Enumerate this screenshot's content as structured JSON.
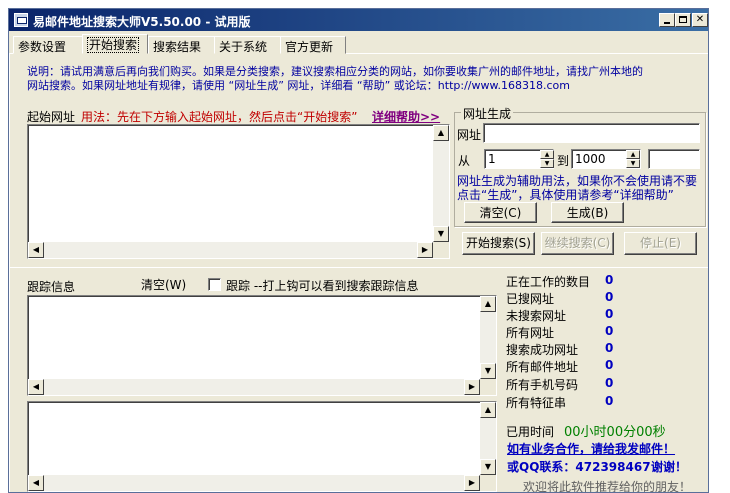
{
  "window": {
    "title": "易邮件地址搜索大师V5.50.00 - 试用版"
  },
  "tabs": [
    {
      "label": "参数设置"
    },
    {
      "label": "开始搜索"
    },
    {
      "label": "搜索结果"
    },
    {
      "label": "关于系统"
    },
    {
      "label": "官方更新"
    }
  ],
  "notice": {
    "line1": "说明：请试用满意后再向我们购买。如果是分类搜索，建议搜索相应分类的网站，如你要收集广州的邮件地址，请找广州本地的",
    "line2": "网站搜索。如果网址地址有规律，请使用 “网址生成” 网址，详细看 “帮助” 或论坛：http://www.168318.com"
  },
  "start_url": {
    "label": "起始网址",
    "usage": "用法：先在下方输入起始网址，然后点击“开始搜索”",
    "help_link": "详细帮助>>",
    "value": ""
  },
  "url_gen": {
    "title": "网址生成",
    "url_label": "网址",
    "url_value": "",
    "from_label": "从",
    "from_value": "1",
    "to_label": "到",
    "to_value": "1000",
    "extra_value": "",
    "hint_line1": "网址生成为辅助用法，如果你不会使用请不要",
    "hint_line2": "点击“生成”，具体使用请参考“详细帮助”",
    "clear_button": "清空(C)",
    "generate_button": "生成(B)"
  },
  "search_buttons": {
    "start": "开始搜索(S)",
    "continue": "继续搜索(C)",
    "stop": "停止(E)"
  },
  "trace": {
    "label": "跟踪信息",
    "clear": "清空(W)",
    "checkbox_label": "跟踪 --打上钩可以看到搜索跟踪信息",
    "checked": false
  },
  "stats": [
    {
      "label": "正在工作的数目",
      "value": "0"
    },
    {
      "label": "已搜网址",
      "value": "0"
    },
    {
      "label": "未搜索网址",
      "value": "0"
    },
    {
      "label": "所有网址",
      "value": "0"
    },
    {
      "label": "搜索成功网址",
      "value": "0"
    },
    {
      "label": "所有邮件地址",
      "value": "0"
    },
    {
      "label": "所有手机号码",
      "value": "0"
    },
    {
      "label": "所有特征串",
      "value": "0"
    }
  ],
  "elapsed": {
    "label": "已用时间",
    "value": "00小时00分00秒"
  },
  "promo": {
    "business": "如有业务合作，请给我发邮件！",
    "qq": "或QQ联系：472398467",
    "thanks": "谢谢！",
    "recommend": "欢迎将此软件推荐给你的朋友！"
  }
}
